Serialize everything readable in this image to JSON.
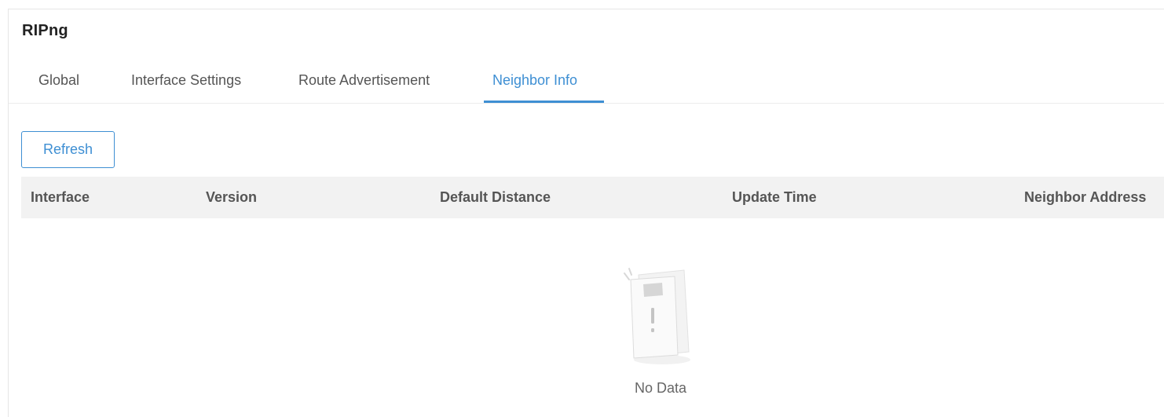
{
  "page": {
    "title": "RIPng"
  },
  "tabs": [
    {
      "label": "Global",
      "active": false
    },
    {
      "label": "Interface Settings",
      "active": false
    },
    {
      "label": "Route Advertisement",
      "active": false
    },
    {
      "label": "Neighbor Info",
      "active": true
    }
  ],
  "toolbar": {
    "refresh_label": "Refresh"
  },
  "table": {
    "columns": [
      "Interface",
      "Version",
      "Default Distance",
      "Update Time",
      "Neighbor Address"
    ],
    "rows": [],
    "empty_text": "No Data"
  },
  "colors": {
    "accent": "#3e8fd3",
    "header_bg": "#f2f2f2"
  },
  "icons": {
    "empty_state": "empty-box-icon"
  }
}
